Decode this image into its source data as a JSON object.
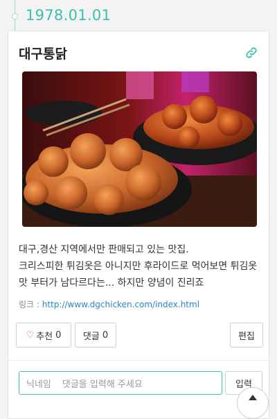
{
  "timeline": {
    "date": "1978.01.01"
  },
  "post": {
    "title": "대구통닭",
    "image": {
      "icon": "fried-chicken-photo"
    },
    "description_lines": [
      "대구,경산 지역에서만 판매되고 있는 맛집.",
      "크리스피한 튀김옷은 아니지만 후라이드로 먹어보면 튀김옷 맛 부터가 남다르다는... 하지만 양념이 진리죠"
    ],
    "link_label": "링크 : ",
    "link_url": "http://www.dgchicken.com/index.html"
  },
  "actions": {
    "like_label": "추천",
    "like_count": "0",
    "comment_label": "댓글",
    "comment_count": "0",
    "edit_label": "편집"
  },
  "comment_form": {
    "nickname_placeholder": "닉네임",
    "comment_placeholder": "댓글을 입력해 주세요",
    "submit_label": "입력"
  },
  "colors": {
    "accent": "#3bbfb0",
    "link": "#2a86c8",
    "heart": "#d9534f"
  }
}
